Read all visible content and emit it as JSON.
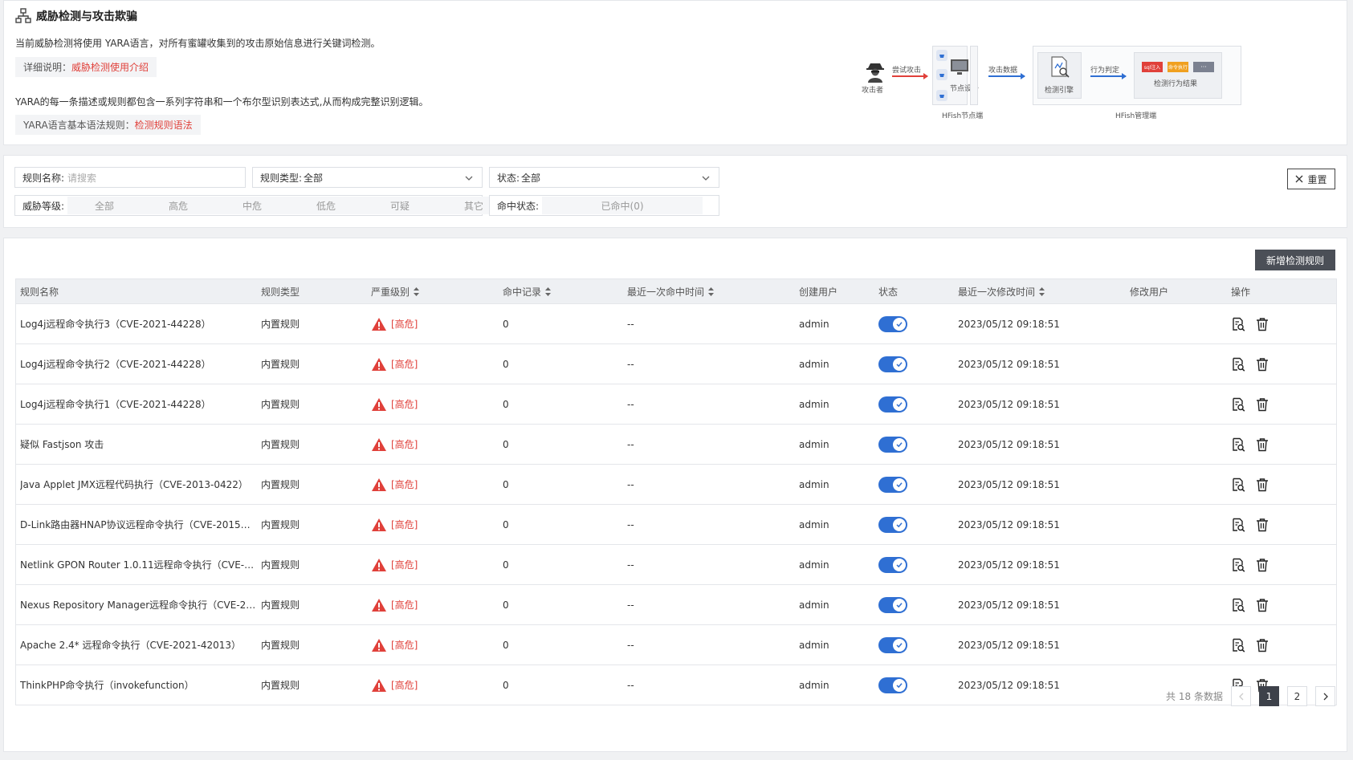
{
  "intro": {
    "title": "威胁检测与攻击欺骗",
    "description": "当前威胁检测将使用 YARA语言，对所有蜜罐收集到的攻击原始信息进行关键词检测。",
    "note1_label": "详细说明：",
    "note1_link": "威胁检测使用介绍",
    "description2": "YARA的每一条描述或规则都包含一系列字符串和一个布尔型识别表达式,从而构成完整识别逻辑。",
    "note2_label": "YARA语言基本语法规则：",
    "note2_link": "检测规则语法"
  },
  "diagram": {
    "attacker": "攻击者",
    "attempt": "尝试攻击",
    "node_device": "节点设备",
    "node_side": "HFish节点端",
    "attack_data": "攻击数据",
    "engine": "检测引擎",
    "judge": "行为判定",
    "result": "检测行为结果",
    "badge1": "sql注入",
    "badge2": "命令执行",
    "badge3": "···",
    "mgmt_side": "HFish管理端"
  },
  "filters": {
    "name_label": "规则名称:",
    "name_placeholder": "请搜索",
    "type_label": "规则类型:",
    "type_value": "全部",
    "status_label": "状态:",
    "status_value": "全部",
    "level_label": "威胁等级:",
    "levels": [
      "全部",
      "高危",
      "中危",
      "低危",
      "可疑",
      "其它"
    ],
    "hit_label": "命中状态:",
    "hit_value": "已命中(0)",
    "reset": "重置"
  },
  "table": {
    "add_button": "新增检测规则",
    "columns": [
      "规则名称",
      "规则类型",
      "严重级别",
      "命中记录",
      "最近一次命中时间",
      "创建用户",
      "状态",
      "最近一次修改时间",
      "修改用户",
      "操作"
    ],
    "rows": [
      {
        "name": "Log4j远程命令执行3（CVE-2021-44228）",
        "type": "内置规则",
        "severity": "[高危]",
        "hits": "0",
        "last_hit": "--",
        "creator": "admin",
        "enabled": true,
        "modified": "2023/05/12 09:18:51",
        "modifier": ""
      },
      {
        "name": "Log4j远程命令执行2（CVE-2021-44228）",
        "type": "内置规则",
        "severity": "[高危]",
        "hits": "0",
        "last_hit": "--",
        "creator": "admin",
        "enabled": true,
        "modified": "2023/05/12 09:18:51",
        "modifier": ""
      },
      {
        "name": "Log4j远程命令执行1（CVE-2021-44228）",
        "type": "内置规则",
        "severity": "[高危]",
        "hits": "0",
        "last_hit": "--",
        "creator": "admin",
        "enabled": true,
        "modified": "2023/05/12 09:18:51",
        "modifier": ""
      },
      {
        "name": "疑似 Fastjson 攻击",
        "type": "内置规则",
        "severity": "[高危]",
        "hits": "0",
        "last_hit": "--",
        "creator": "admin",
        "enabled": true,
        "modified": "2023/05/12 09:18:51",
        "modifier": ""
      },
      {
        "name": "Java Applet JMX远程代码执行（CVE-2013-0422）",
        "type": "内置规则",
        "severity": "[高危]",
        "hits": "0",
        "last_hit": "--",
        "creator": "admin",
        "enabled": true,
        "modified": "2023/05/12 09:18:51",
        "modifier": ""
      },
      {
        "name": "D-Link路由器HNAP协议远程命令执行（CVE-2015…",
        "type": "内置规则",
        "severity": "[高危]",
        "hits": "0",
        "last_hit": "--",
        "creator": "admin",
        "enabled": true,
        "modified": "2023/05/12 09:18:51",
        "modifier": ""
      },
      {
        "name": "Netlink GPON Router 1.0.11远程命令执行（CVE-…",
        "type": "内置规则",
        "severity": "[高危]",
        "hits": "0",
        "last_hit": "--",
        "creator": "admin",
        "enabled": true,
        "modified": "2023/05/12 09:18:51",
        "modifier": ""
      },
      {
        "name": "Nexus Repository Manager远程命令执行（CVE-2…",
        "type": "内置规则",
        "severity": "[高危]",
        "hits": "0",
        "last_hit": "--",
        "creator": "admin",
        "enabled": true,
        "modified": "2023/05/12 09:18:51",
        "modifier": ""
      },
      {
        "name": "Apache 2.4* 远程命令执行（CVE-2021-42013）",
        "type": "内置规则",
        "severity": "[高危]",
        "hits": "0",
        "last_hit": "--",
        "creator": "admin",
        "enabled": true,
        "modified": "2023/05/12 09:18:51",
        "modifier": ""
      },
      {
        "name": "ThinkPHP命令执行（invokefunction）",
        "type": "内置规则",
        "severity": "[高危]",
        "hits": "0",
        "last_hit": "--",
        "creator": "admin",
        "enabled": true,
        "modified": "2023/05/12 09:18:51",
        "modifier": ""
      }
    ]
  },
  "pagination": {
    "total_prefix": "共",
    "total": "18",
    "total_suffix": "条数据",
    "pages": [
      "1",
      "2"
    ],
    "current": "1"
  },
  "colors": {
    "accent": "#2f6fd3",
    "danger": "#e0403a",
    "dark_button": "#4b4f57"
  }
}
